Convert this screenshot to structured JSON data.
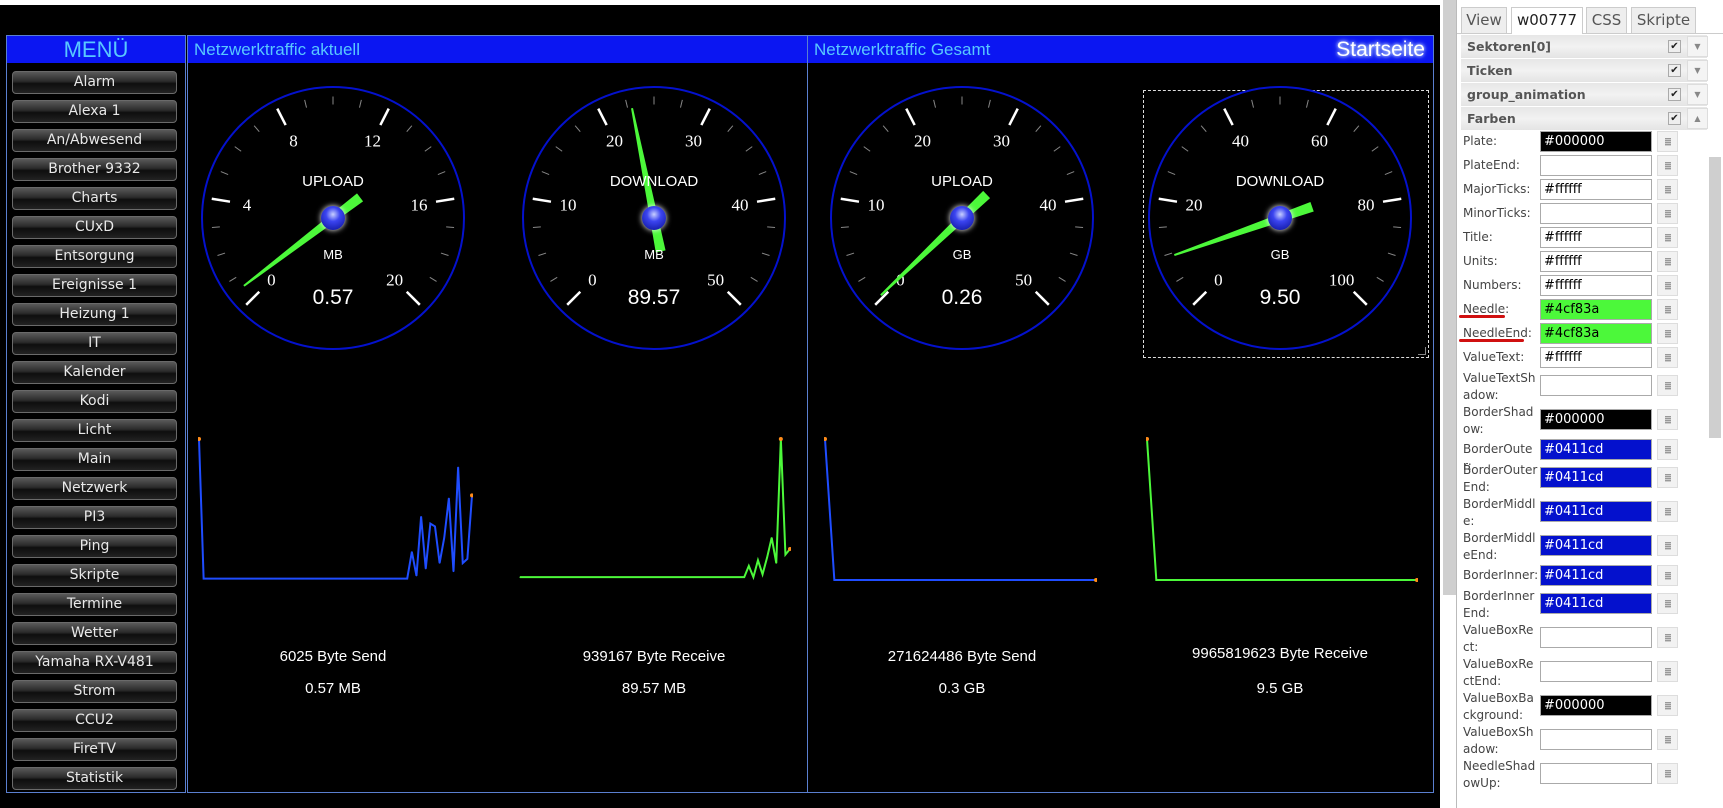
{
  "menu": {
    "title": "MENÜ",
    "items": [
      "Alarm",
      "Alexa 1",
      "An/Abwesend",
      "Brother 9332",
      "Charts",
      "CUxD",
      "Entsorgung",
      "Ereignisse 1",
      "Heizung 1",
      "IT",
      "Kalender",
      "Kodi",
      "Licht",
      "Main",
      "Netzwerk",
      "PI3",
      "Ping",
      "Skripte",
      "Termine",
      "Wetter",
      "Yamaha RX-V481",
      "Strom",
      "CCU2",
      "FireTV",
      "Statistik"
    ]
  },
  "main": {
    "section_current": "Netzwerktraffic aktuell",
    "section_total": "Netzwerktraffic Gesamt",
    "page_label": "Startseite",
    "gauges": [
      {
        "title": "UPLOAD",
        "unit": "MB",
        "min": 0,
        "max": 20,
        "major_step": 4,
        "value": 0.57,
        "value_text": "0.57",
        "bytes_text": "6025 Byte Send",
        "amount_text": "0.57 MB"
      },
      {
        "title": "DOWNLOAD",
        "unit": "MB",
        "min": 0,
        "max": 50,
        "major_step": 10,
        "value": 89.57,
        "value_text": "89.57",
        "bytes_text": "939167 Byte Receive",
        "amount_text": "89.57 MB"
      },
      {
        "title": "UPLOAD",
        "unit": "GB",
        "min": 0,
        "max": 50,
        "major_step": 10,
        "value": 0.26,
        "value_text": "0.26",
        "bytes_text": "271624486 Byte Send",
        "amount_text": "0.3 GB"
      },
      {
        "title": "DOWNLOAD",
        "unit": "GB",
        "min": 0,
        "max": 100,
        "major_step": 20,
        "value": 9.5,
        "value_text": "9.50",
        "bytes_text": "9965819623 Byte Receive",
        "amount_text": "9.5 GB",
        "selected": true
      }
    ]
  },
  "chart_data": [
    {
      "type": "line",
      "color": "#1f4dff",
      "values": [
        100,
        1,
        1,
        1,
        1,
        1,
        1,
        1,
        1,
        1,
        1,
        1,
        1,
        1,
        1,
        1,
        1,
        1,
        1,
        1,
        1,
        1,
        1,
        1,
        1,
        1,
        1,
        1,
        1,
        1,
        1,
        1,
        1,
        1,
        1,
        1,
        1,
        1,
        1,
        1,
        1,
        1,
        1,
        1,
        1,
        1,
        20,
        3,
        45,
        8,
        40,
        38,
        12,
        30,
        58,
        6,
        80,
        12,
        15,
        60
      ]
    },
    {
      "type": "line",
      "color": "#4cf83a",
      "values": [
        2,
        2,
        2,
        2,
        2,
        2,
        2,
        2,
        2,
        2,
        2,
        2,
        2,
        2,
        2,
        2,
        2,
        2,
        2,
        2,
        2,
        2,
        2,
        2,
        2,
        2,
        2,
        2,
        2,
        2,
        2,
        2,
        2,
        2,
        2,
        2,
        2,
        2,
        2,
        2,
        2,
        2,
        2,
        2,
        2,
        2,
        2,
        2,
        2,
        2,
        10,
        2,
        14,
        4,
        16,
        30,
        12,
        100,
        18,
        22
      ]
    },
    {
      "type": "line",
      "color": "#1f4dff",
      "values": [
        100,
        0,
        0,
        0,
        0,
        0,
        0,
        0,
        0,
        0,
        0,
        0,
        0,
        0,
        0,
        0,
        0,
        0,
        0,
        0,
        0,
        0,
        0,
        0,
        0,
        0,
        0,
        0,
        0,
        0
      ]
    },
    {
      "type": "line",
      "color": "#4cf83a",
      "values": [
        100,
        0,
        0,
        0,
        0,
        0,
        0,
        0,
        0,
        0,
        0,
        0,
        0,
        0,
        0,
        0,
        0,
        0,
        0,
        0,
        0,
        0,
        0,
        0,
        0,
        0,
        0,
        0,
        0,
        0
      ]
    }
  ],
  "colors": {
    "needle": "#4cf83a",
    "border": "#0411cd",
    "header": "#0b16f2",
    "header_text": "#58c8ff",
    "marker": "#ff8c1a"
  },
  "editor": {
    "tabs": [
      "View",
      "w00777",
      "CSS",
      "Skripte"
    ],
    "active_tab": "w00777",
    "groups": [
      {
        "label": "Sektoren[0]",
        "checked": true,
        "expanded": false
      },
      {
        "label": "Ticken",
        "checked": true,
        "expanded": false
      },
      {
        "label": "group_animation",
        "checked": true,
        "expanded": false
      },
      {
        "label": "Farben",
        "checked": true,
        "expanded": true
      }
    ],
    "properties": [
      {
        "label": "Plate:",
        "value": "#000000",
        "bg": "#000000",
        "fg": "#ffffff"
      },
      {
        "label": "PlateEnd:",
        "value": ""
      },
      {
        "label": "MajorTicks:",
        "value": "#ffffff"
      },
      {
        "label": "MinorTicks:",
        "value": ""
      },
      {
        "label": "Title:",
        "value": "#ffffff"
      },
      {
        "label": "Units:",
        "value": "#ffffff"
      },
      {
        "label": "Numbers:",
        "value": "#ffffff"
      },
      {
        "label": "Needle:",
        "value": "#4cf83a",
        "bg": "#4cf83a",
        "fg": "#000000",
        "underlined": true
      },
      {
        "label": "NeedleEnd:",
        "value": "#4cf83a",
        "bg": "#4cf83a",
        "fg": "#000000",
        "underlined": true
      },
      {
        "label": "ValueText:",
        "value": "#ffffff"
      },
      {
        "label": "ValueTextShadow:",
        "value": ""
      },
      {
        "label": "BorderShadow:",
        "value": "#000000",
        "bg": "#000000",
        "fg": "#ffffff"
      },
      {
        "label": "BorderOuter:",
        "value": "#0411cd",
        "bg": "#0411cd",
        "fg": "#ffffff"
      },
      {
        "label": "BorderOuterEnd:",
        "value": "#0411cd",
        "bg": "#0411cd",
        "fg": "#ffffff"
      },
      {
        "label": "BorderMiddle:",
        "value": "#0411cd",
        "bg": "#0411cd",
        "fg": "#ffffff"
      },
      {
        "label": "BorderMiddleEnd:",
        "value": "#0411cd",
        "bg": "#0411cd",
        "fg": "#ffffff"
      },
      {
        "label": "BorderInner:",
        "value": "#0411cd",
        "bg": "#0411cd",
        "fg": "#ffffff"
      },
      {
        "label": "BorderInnerEnd:",
        "value": "#0411cd",
        "bg": "#0411cd",
        "fg": "#ffffff"
      },
      {
        "label": "ValueBoxRect:",
        "value": ""
      },
      {
        "label": "ValueBoxRectEnd:",
        "value": ""
      },
      {
        "label": "ValueBoxBackground:",
        "value": "#000000",
        "bg": "#000000",
        "fg": "#ffffff"
      },
      {
        "label": "ValueBoxShadow:",
        "value": ""
      },
      {
        "label": "NeedleShadowUp:",
        "value": ""
      }
    ]
  }
}
